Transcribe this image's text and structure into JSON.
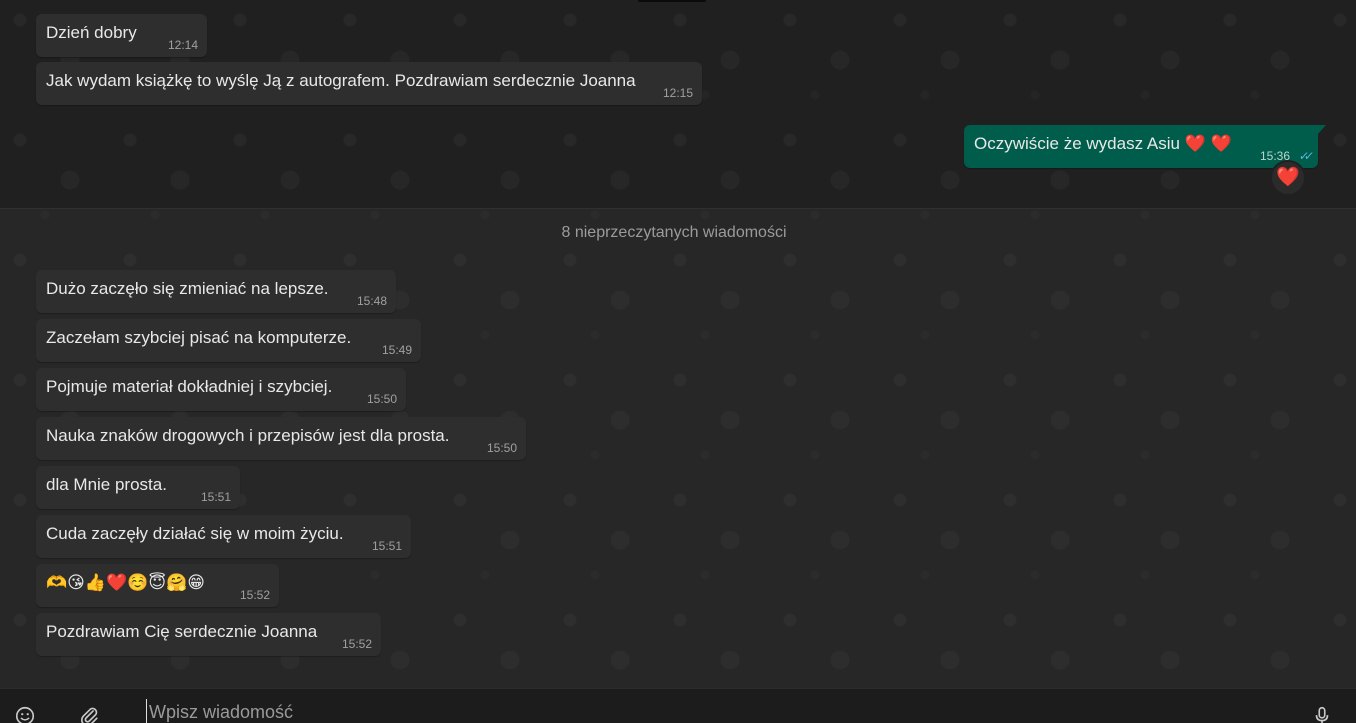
{
  "messages_before": [
    {
      "text": "Dzień dobry",
      "time": "12:14"
    },
    {
      "text": "Jak wydam książkę to wyślę Ją z autografem. Pozdrawiam serdecznie Joanna",
      "time": "12:15"
    }
  ],
  "outgoing": {
    "text": "Oczywiście że wydasz Asiu",
    "hearts": "❤️ ❤️",
    "time": "15:36",
    "ticks": "✓✓",
    "reaction": "❤️"
  },
  "unread_divider": "8 nieprzeczytanych wiadomości",
  "messages_unread": [
    {
      "text": "Dużo zaczęło się zmieniać na lepsze.",
      "time": "15:48"
    },
    {
      "text": "Zaczełam szybciej pisać na komputerze.",
      "time": "15:49"
    },
    {
      "text": "Pojmuje materiał dokładniej i szybciej.",
      "time": "15:50"
    },
    {
      "text": "Nauka znaków drogowych i przepisów jest dla prosta.",
      "time": "15:50"
    },
    {
      "text": "dla Mnie prosta.",
      "time": "15:51"
    },
    {
      "text": "Cuda zaczęły działać się w moim życiu.",
      "time": "15:51"
    },
    {
      "text": "🫶😘👍❤️☺️😇🤗😁",
      "time": "15:52"
    },
    {
      "text": "Pozdrawiam Cię serdecznie Joanna",
      "time": "15:52"
    }
  ],
  "composer": {
    "placeholder": "Wpisz wiadomość",
    "emoji_icon": "emoji-icon",
    "attach_icon": "paperclip-icon",
    "mic_icon": "microphone-icon"
  },
  "colors": {
    "background": "#202020",
    "incoming_bubble": "#2e2e2e",
    "outgoing_bubble": "#005c4b",
    "read_ticks": "#53bdeb",
    "heart": "#ff3043"
  }
}
